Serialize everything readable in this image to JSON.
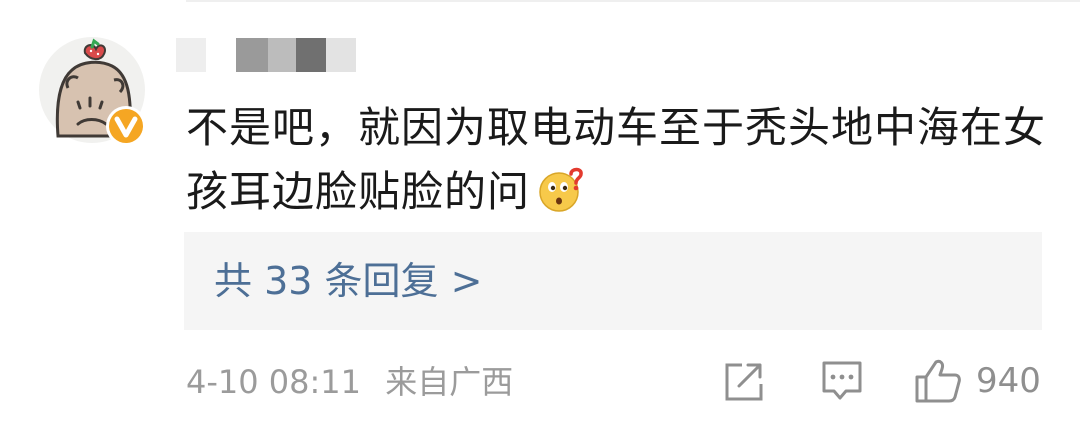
{
  "comment": {
    "author": {
      "avatar_icon": "bald-character-avatar-icon",
      "badge_icon": "verified-v-badge-icon",
      "name_obscured": true
    },
    "text": "不是吧，就因为取电动车至于秃头地中海在女孩耳边脸贴脸的问",
    "emoji_icon": "confused-face-question-icon",
    "replies_label": "共 33 条回复 >",
    "timestamp": "4-10 08:11",
    "location": "来自广西",
    "share_icon": "share-icon",
    "comment_icon": "comment-icon",
    "like_icon": "thumbs-up-icon",
    "like_count": "940"
  },
  "colors": {
    "text": "#1a1a1a",
    "link": "#4d6f96",
    "meta": "#9b9b9b",
    "reply_bg": "#f5f5f5",
    "badge": "#f5a623"
  }
}
